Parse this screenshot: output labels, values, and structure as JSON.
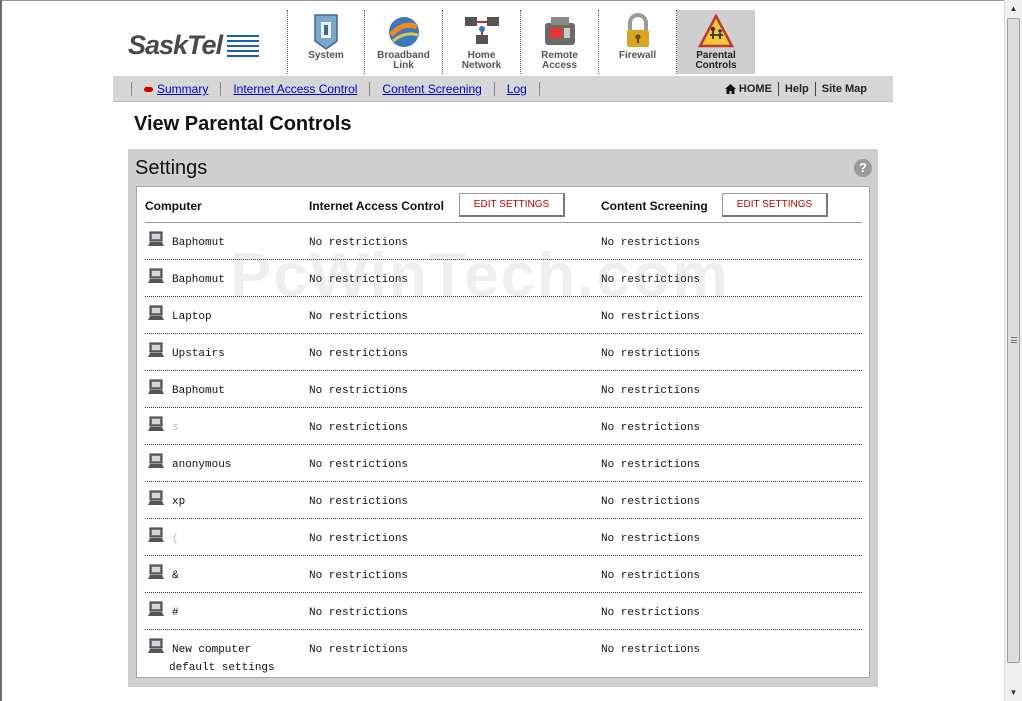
{
  "brand": {
    "logo_text": "SaskTel"
  },
  "top_nav": [
    {
      "label_1": "System",
      "label_2": "",
      "icon": "system-icon"
    },
    {
      "label_1": "Broadband",
      "label_2": "Link",
      "icon": "broadband-link-icon"
    },
    {
      "label_1": "Home",
      "label_2": "Network",
      "icon": "home-network-icon"
    },
    {
      "label_1": "Remote",
      "label_2": "Access",
      "icon": "remote-access-icon"
    },
    {
      "label_1": "Firewall",
      "label_2": "",
      "icon": "firewall-lock-icon"
    },
    {
      "label_1": "Parental",
      "label_2": "Controls",
      "icon": "parental-controls-icon",
      "active": true
    }
  ],
  "sub_nav": {
    "links": [
      "Summary",
      "Internet Access Control",
      "Content Screening",
      "Log"
    ],
    "utility": [
      "HOME",
      "Help",
      "Site Map"
    ]
  },
  "page": {
    "title": "View Parental Controls"
  },
  "panel": {
    "title": "Settings",
    "help_glyph": "?",
    "columns": {
      "computer": "Computer",
      "iac": "Internet Access Control",
      "cs": "Content Screening",
      "edit_label": "EDIT SETTINGS"
    },
    "rows": [
      {
        "name": "Baphomut",
        "iac": "No restrictions",
        "cs": "No restrictions"
      },
      {
        "name": "Baphomut",
        "iac": "No restrictions",
        "cs": "No restrictions"
      },
      {
        "name": "Laptop",
        "iac": "No restrictions",
        "cs": "No restrictions"
      },
      {
        "name": "Upstairs",
        "iac": "No restrictions",
        "cs": "No restrictions"
      },
      {
        "name": "Baphomut",
        "iac": "No restrictions",
        "cs": "No restrictions"
      },
      {
        "name": "s",
        "iac": "No restrictions",
        "cs": "No restrictions"
      },
      {
        "name": "anonymous",
        "iac": "No restrictions",
        "cs": "No restrictions"
      },
      {
        "name": "xp",
        "iac": "No restrictions",
        "cs": "No restrictions"
      },
      {
        "name": "(",
        "iac": "No restrictions",
        "cs": "No restrictions"
      },
      {
        "name": "&",
        "iac": "No restrictions",
        "cs": "No restrictions"
      },
      {
        "name": "#",
        "iac": "No restrictions",
        "cs": "No restrictions"
      }
    ],
    "last_row": {
      "name_1": "New computer",
      "name_2": "default settings",
      "iac": "No restrictions",
      "cs": "No restrictions"
    }
  },
  "watermark": "PcWinTech.com",
  "colors": {
    "link": "#0000cc",
    "edit_text": "#c00000",
    "accent_blue": "#1b5fae",
    "panel_gray": "#cfcfcf"
  }
}
